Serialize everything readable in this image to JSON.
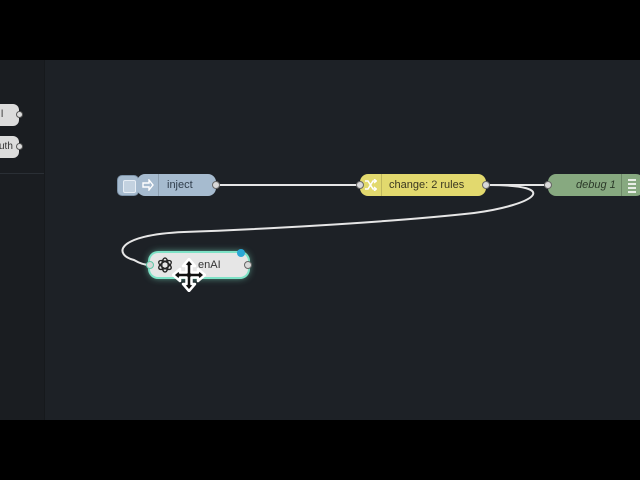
{
  "palette": {
    "items": [
      {
        "label": "l",
        "icon": "node-port"
      },
      {
        "label": "uth",
        "icon": "node-port"
      }
    ]
  },
  "nodes": {
    "inject": {
      "label": "inject",
      "color": "#a6bbcf"
    },
    "change": {
      "label": "change: 2 rules",
      "color": "#e2d96e"
    },
    "debug": {
      "label": "debug 1",
      "color": "#87a980"
    },
    "openai": {
      "label": "enAI",
      "color": "#e6e6e6",
      "highlight": "#7ee2c6"
    }
  },
  "colors": {
    "canvas": "#1d2126",
    "wire": "#e6e6e6",
    "changed_marker": "#2aa7d6"
  },
  "cursor": {
    "icon": "move-cursor-icon"
  }
}
